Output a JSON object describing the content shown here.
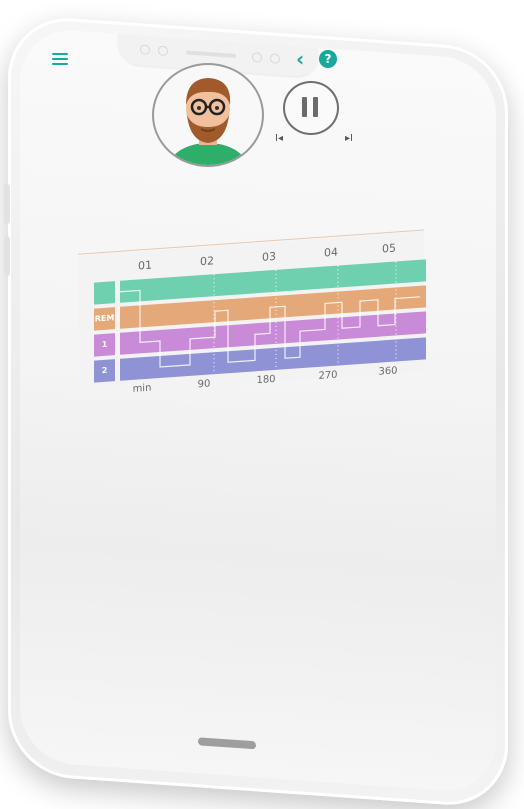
{
  "colors": {
    "accent": "#1aa79c",
    "awake": "#6fd0b0",
    "rem": "#e5a878",
    "stage1": "#c98ad8",
    "stage2": "#8f93d6"
  },
  "header": {
    "menu_icon": "hamburger-menu-icon",
    "back_icon": "chevron-left-icon",
    "help_icon": "question-circle-icon",
    "back_glyph": "‹",
    "help_glyph": "?"
  },
  "player": {
    "avatar": "avatar-man-glasses-beard",
    "pause_icon": "pause-icon",
    "prev_glyph": "I◂",
    "next_glyph": "▸I"
  },
  "chart": {
    "hours": [
      "01",
      "02",
      "03",
      "04",
      "05"
    ],
    "stages": [
      {
        "key": "awake",
        "label": "",
        "icon": "rooster-icon"
      },
      {
        "key": "rem",
        "label": "REM"
      },
      {
        "key": "stage1",
        "label": "1"
      },
      {
        "key": "stage2",
        "label": "2"
      }
    ],
    "x_axis_labels": [
      "min",
      "90",
      "180",
      "270",
      "360"
    ]
  }
}
